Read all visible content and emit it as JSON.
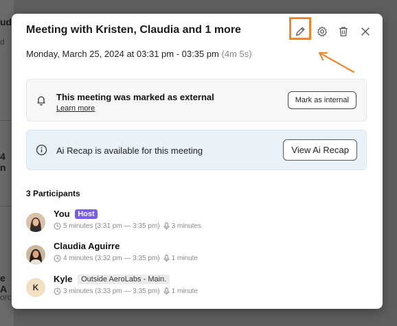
{
  "background": {
    "fragments": [
      "ud",
      "d",
      "4 n",
      "e A",
      "orc"
    ]
  },
  "modal": {
    "title": "Meeting with Kristen, Claudia and 1 more",
    "date": "Monday, March 25, 2024 at 03:31 pm - 03:35 pm",
    "duration": "(4m 5s)",
    "toolbar": {
      "edit": "edit-icon",
      "settings": "gear-icon",
      "delete": "trash-icon",
      "close": "close-icon"
    },
    "external": {
      "title": "This meeting was marked as external",
      "link": "Learn more",
      "button": "Mark as internal"
    },
    "recap": {
      "text": "Ai Recap is available for this meeting",
      "button": "View Ai Recap"
    },
    "participants_heading": "3 Participants",
    "participants": [
      {
        "name": "You",
        "badge": "Host",
        "time": "5 minutes (3:31 pm — 3:35 pm)",
        "talk": "3 minutes"
      },
      {
        "name": "Claudia Aguirre",
        "badge": "",
        "time": "4 minutes (3:32 pm — 3:35 pm)",
        "talk": "1 minute"
      },
      {
        "name": "Kyle",
        "initial": "K",
        "badge": "Outside AeroLabs - Main.",
        "time": "3 minutes (3:33 pm — 3:35 pm)",
        "talk": "1 minute"
      }
    ]
  },
  "colors": {
    "accent_highlight": "#f0862c",
    "host_badge": "#7a5cf0",
    "recap_bg": "#e9f1f9"
  }
}
